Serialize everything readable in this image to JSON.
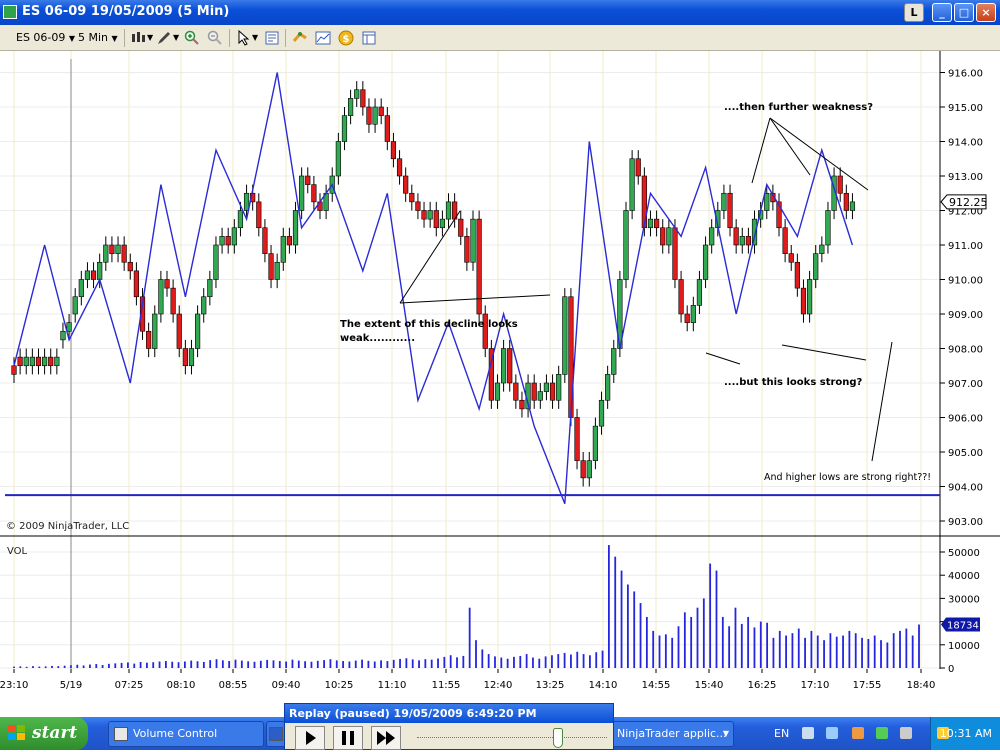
{
  "window": {
    "title": "ES 06-09  19/05/2009  (5 Min)",
    "buttons": [
      "L",
      "_",
      "□",
      "×"
    ]
  },
  "toolbar": {
    "instrument": "ES 06-09",
    "interval": "5 Min",
    "icons": [
      "bar-type-icon",
      "drawing-pencil-icon",
      "zoom-in-icon",
      "zoom-out-icon",
      "cursor-icon",
      "properties-icon",
      "strategy-icon",
      "indicator-icon",
      "dollar-icon",
      "data-box-icon"
    ]
  },
  "chart": {
    "copyright": "© 2009 NinjaTrader, LLC",
    "volume_label": "VOL",
    "last_price": "912.25",
    "last_volume": "18734",
    "colors": {
      "up": "#32a852",
      "down": "#e01b1b",
      "zigzag": "#2b2bd6",
      "support": "#2424c8",
      "volume": "#2525e0",
      "price_marker": "#1018a8"
    },
    "annotations": [
      {
        "text": "....then further weakness?"
      },
      {
        "text": "The extent of this decline looks"
      },
      {
        "text": "weak............"
      },
      {
        "text": "....but this looks strong?"
      },
      {
        "text": "And higher lows are strong right??!"
      }
    ]
  },
  "chart_data": {
    "type": "candlestick",
    "instrument": "ES 06-09",
    "interval": "5 Min",
    "price_axis": {
      "ticks": [
        903,
        904,
        905,
        906,
        907,
        908,
        909,
        910,
        911,
        912,
        913,
        914,
        915,
        916
      ],
      "range": [
        902.75,
        916.25
      ]
    },
    "time_axis": {
      "ticks": [
        "23:10",
        "5/19",
        "07:25",
        "08:10",
        "08:55",
        "09:40",
        "10:25",
        "11:10",
        "11:55",
        "12:40",
        "13:25",
        "14:10",
        "14:55",
        "15:40",
        "16:25",
        "17:10",
        "17:55",
        "18:40"
      ]
    },
    "support_line": 903.75,
    "volume_axis": {
      "ticks": [
        0,
        10000,
        20000,
        30000,
        40000,
        50000
      ],
      "range": [
        0,
        55000
      ]
    },
    "grid": true,
    "candles": [
      [
        907.5,
        907.25
      ],
      [
        907.75,
        907.5
      ],
      [
        907.5,
        907.75
      ],
      [
        907.5,
        907.75
      ],
      [
        907.75,
        907.5
      ],
      [
        907.5,
        907.75
      ],
      [
        907.75,
        907.5
      ],
      [
        907.5,
        907.75
      ],
      [
        908.25,
        908.5
      ],
      [
        908.5,
        908.75
      ],
      [
        909,
        909.5
      ],
      [
        909.5,
        910
      ],
      [
        910,
        910.25
      ],
      [
        910.25,
        910
      ],
      [
        910,
        910.5
      ],
      [
        910.5,
        911
      ],
      [
        911,
        910.75
      ],
      [
        910.75,
        911
      ],
      [
        911,
        910.5
      ],
      [
        910.5,
        910.25
      ],
      [
        910.25,
        909.5
      ],
      [
        909.5,
        908.5
      ],
      [
        908.5,
        908
      ],
      [
        908,
        909
      ],
      [
        909,
        910
      ],
      [
        910,
        909.75
      ],
      [
        909.75,
        909
      ],
      [
        909,
        908
      ],
      [
        908,
        907.5
      ],
      [
        907.5,
        908
      ],
      [
        908,
        909
      ],
      [
        909,
        909.5
      ],
      [
        909.5,
        910
      ],
      [
        910,
        911
      ],
      [
        911,
        911.25
      ],
      [
        911.25,
        911
      ],
      [
        911,
        911.5
      ],
      [
        911.5,
        912
      ],
      [
        912,
        912.5
      ],
      [
        912.5,
        912.25
      ],
      [
        912.25,
        911.5
      ],
      [
        911.5,
        910.75
      ],
      [
        910.75,
        910
      ],
      [
        910,
        910.5
      ],
      [
        910.5,
        911.25
      ],
      [
        911.25,
        911
      ],
      [
        911,
        912
      ],
      [
        912,
        913
      ],
      [
        913,
        912.75
      ],
      [
        912.75,
        912.25
      ],
      [
        912.25,
        912
      ],
      [
        912,
        912.5
      ],
      [
        912.5,
        913
      ],
      [
        913,
        914
      ],
      [
        914,
        914.75
      ],
      [
        914.75,
        915.25
      ],
      [
        915.25,
        915.5
      ],
      [
        915.5,
        915
      ],
      [
        915,
        914.5
      ],
      [
        914.5,
        915
      ],
      [
        915,
        914.75
      ],
      [
        914.75,
        914
      ],
      [
        914,
        913.5
      ],
      [
        913.5,
        913
      ],
      [
        913,
        912.5
      ],
      [
        912.5,
        912.25
      ],
      [
        912.25,
        912
      ],
      [
        912,
        911.75
      ],
      [
        911.75,
        912
      ],
      [
        912,
        911.5
      ],
      [
        911.5,
        911.75
      ],
      [
        911.75,
        912.25
      ],
      [
        912.25,
        911.75
      ],
      [
        911.75,
        911.25
      ],
      [
        911.25,
        910.5
      ],
      [
        910.5,
        911.75
      ],
      [
        911.75,
        909
      ],
      [
        909,
        908
      ],
      [
        908,
        906.5
      ],
      [
        906.5,
        907
      ],
      [
        907,
        908
      ],
      [
        908,
        907
      ],
      [
        907,
        906.5
      ],
      [
        906.5,
        906.25
      ],
      [
        906.25,
        907
      ],
      [
        907,
        906.5
      ],
      [
        906.5,
        906.75
      ],
      [
        906.75,
        907
      ],
      [
        907,
        906.5
      ],
      [
        906.5,
        907.25
      ],
      [
        907.25,
        909.5
      ],
      [
        909.5,
        906
      ],
      [
        906,
        904.75
      ],
      [
        904.75,
        904.25
      ],
      [
        904.25,
        904.75
      ],
      [
        904.75,
        905.75
      ],
      [
        905.75,
        906.5
      ],
      [
        906.5,
        907.25
      ],
      [
        907.25,
        908
      ],
      [
        908,
        910
      ],
      [
        910,
        912
      ],
      [
        912,
        913.5
      ],
      [
        913.5,
        913
      ],
      [
        913,
        911.5
      ],
      [
        911.5,
        911.75
      ],
      [
        911.75,
        911.5
      ],
      [
        911.5,
        911
      ],
      [
        911,
        911.5
      ],
      [
        911.5,
        910
      ],
      [
        910,
        909
      ],
      [
        909,
        908.75
      ],
      [
        908.75,
        909.25
      ],
      [
        909.25,
        910
      ],
      [
        910,
        911
      ],
      [
        911,
        911.5
      ],
      [
        911.5,
        912
      ],
      [
        912,
        912.5
      ],
      [
        912.5,
        911.5
      ],
      [
        911.5,
        911
      ],
      [
        911,
        911.25
      ],
      [
        911.25,
        911
      ],
      [
        911,
        911.75
      ],
      [
        911.75,
        912
      ],
      [
        912,
        912.5
      ],
      [
        912.5,
        912.25
      ],
      [
        912.25,
        911.5
      ],
      [
        911.5,
        910.75
      ],
      [
        910.75,
        910.5
      ],
      [
        910.5,
        909.75
      ],
      [
        909.75,
        909
      ],
      [
        909,
        910
      ],
      [
        910,
        910.75
      ],
      [
        910.75,
        911
      ],
      [
        911,
        912
      ],
      [
        912,
        913
      ],
      [
        913,
        912.5
      ],
      [
        912.5,
        912
      ],
      [
        912,
        912.25
      ]
    ],
    "volume": [
      600,
      700,
      500,
      800,
      600,
      700,
      900,
      800,
      1000,
      1200,
      1400,
      1100,
      1500,
      1700,
      1300,
      1800,
      2000,
      2200,
      2400,
      1900,
      2600,
      2300,
      2500,
      2800,
      3000,
      2700,
      2500,
      2800,
      3200,
      2900,
      2600,
      3400,
      3800,
      3300,
      3000,
      3600,
      3200,
      2900,
      2700,
      3100,
      3500,
      3300,
      3000,
      2800,
      3600,
      3200,
      2900,
      2700,
      3100,
      3400,
      3800,
      3300,
      3000,
      2800,
      3200,
      3600,
      3100,
      2800,
      3300,
      3000,
      3500,
      3900,
      4200,
      3700,
      3300,
      3800,
      3600,
      4100,
      4800,
      5500,
      4600,
      5200,
      26000,
      12000,
      8000,
      6000,
      5000,
      4500,
      4000,
      4800,
      5200,
      6000,
      4500,
      4000,
      5000,
      5500,
      6000,
      6500,
      5800,
      7000,
      6000,
      5500,
      6800,
      7500,
      53000,
      48000,
      42000,
      36000,
      33000,
      28000,
      22000,
      16000,
      14000,
      14500,
      13000,
      18000,
      24000,
      22000,
      26000,
      30000,
      45000,
      42000,
      22000,
      18000,
      26000,
      19000,
      22000,
      17500,
      20000,
      19500,
      13000,
      16000,
      14000,
      15000,
      17000,
      13000,
      16000,
      14000,
      12000,
      15000,
      13500,
      14000,
      16000,
      15000,
      13000,
      12500,
      14000,
      12000,
      11000,
      15000,
      16000,
      17000,
      14000,
      18734
    ],
    "zigzag": [
      907.5,
      911,
      908.25,
      910,
      907,
      912.75,
      909.5,
      913.75,
      911.75,
      916,
      911.5,
      912.75,
      910.25,
      912.5,
      906.5,
      908.75,
      906.25,
      909,
      905.75,
      903.5,
      914,
      908,
      912.5,
      911.25,
      913.25,
      909,
      912.75,
      911.25,
      913.75,
      911
    ]
  },
  "taskbar": {
    "start": "start",
    "tasks": [
      "Volume Control",
      "",
      "NinjaTrader applic..."
    ],
    "language": "EN",
    "clock": "10:31 AM"
  },
  "replay": {
    "title": "Replay (paused) 19/05/2009 6:49:20 PM"
  }
}
